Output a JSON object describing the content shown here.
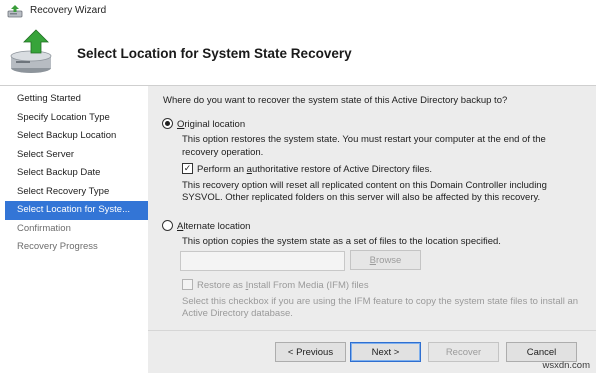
{
  "window": {
    "title": "Recovery Wizard"
  },
  "header": {
    "heading": "Select Location for System State Recovery"
  },
  "steps": [
    {
      "label": "Getting Started",
      "state": "normal"
    },
    {
      "label": "Specify Location Type",
      "state": "normal"
    },
    {
      "label": "Select Backup Location",
      "state": "normal"
    },
    {
      "label": "Select Server",
      "state": "normal"
    },
    {
      "label": "Select Backup Date",
      "state": "normal"
    },
    {
      "label": "Select Recovery Type",
      "state": "normal"
    },
    {
      "label": "Select Location for Syste...",
      "state": "active"
    },
    {
      "label": "Confirmation",
      "state": "disabled"
    },
    {
      "label": "Recovery Progress",
      "state": "disabled"
    }
  ],
  "content": {
    "question": "Where do you want to recover the system state of this Active Directory backup to?",
    "original": {
      "label_key": "O",
      "label_rest": "riginal location",
      "selected": true,
      "desc1": "This option restores the system state. You must restart your computer at the end of the",
      "desc2": "recovery operation.",
      "auth_pre": "Perform an ",
      "auth_key": "a",
      "auth_rest": "uthoritative restore of Active Directory files.",
      "auth_checked": true,
      "auth_desc1": "This recovery option will reset all replicated content on this Domain Controller including",
      "auth_desc2": "SYSVOL. Other replicated folders on this server will also be affected by this recovery."
    },
    "alternate": {
      "label_key": "A",
      "label_rest": "lternate location",
      "selected": false,
      "desc": "This option copies the system state as a set of files to the location specified.",
      "path_value": "",
      "browse_key": "B",
      "browse_rest": "rowse",
      "ifm_pre": "Restore as ",
      "ifm_key": "I",
      "ifm_rest": "nstall From Media (IFM) files",
      "ifm_checked": false,
      "ifm_desc1": "Select this checkbox if you are using the IFM feature to copy the system state files to install an",
      "ifm_desc2": "Active Directory database."
    }
  },
  "buttons": {
    "previous": "< Previous",
    "next": "Next >",
    "recover": "Recover",
    "cancel": "Cancel"
  },
  "watermark": "wsxdn.com",
  "colors": {
    "active_step": "#3375d6",
    "content_bg": "#ececec"
  },
  "icons": {
    "app": "recovery-wizard-icon",
    "header": "drive-restore-icon"
  }
}
